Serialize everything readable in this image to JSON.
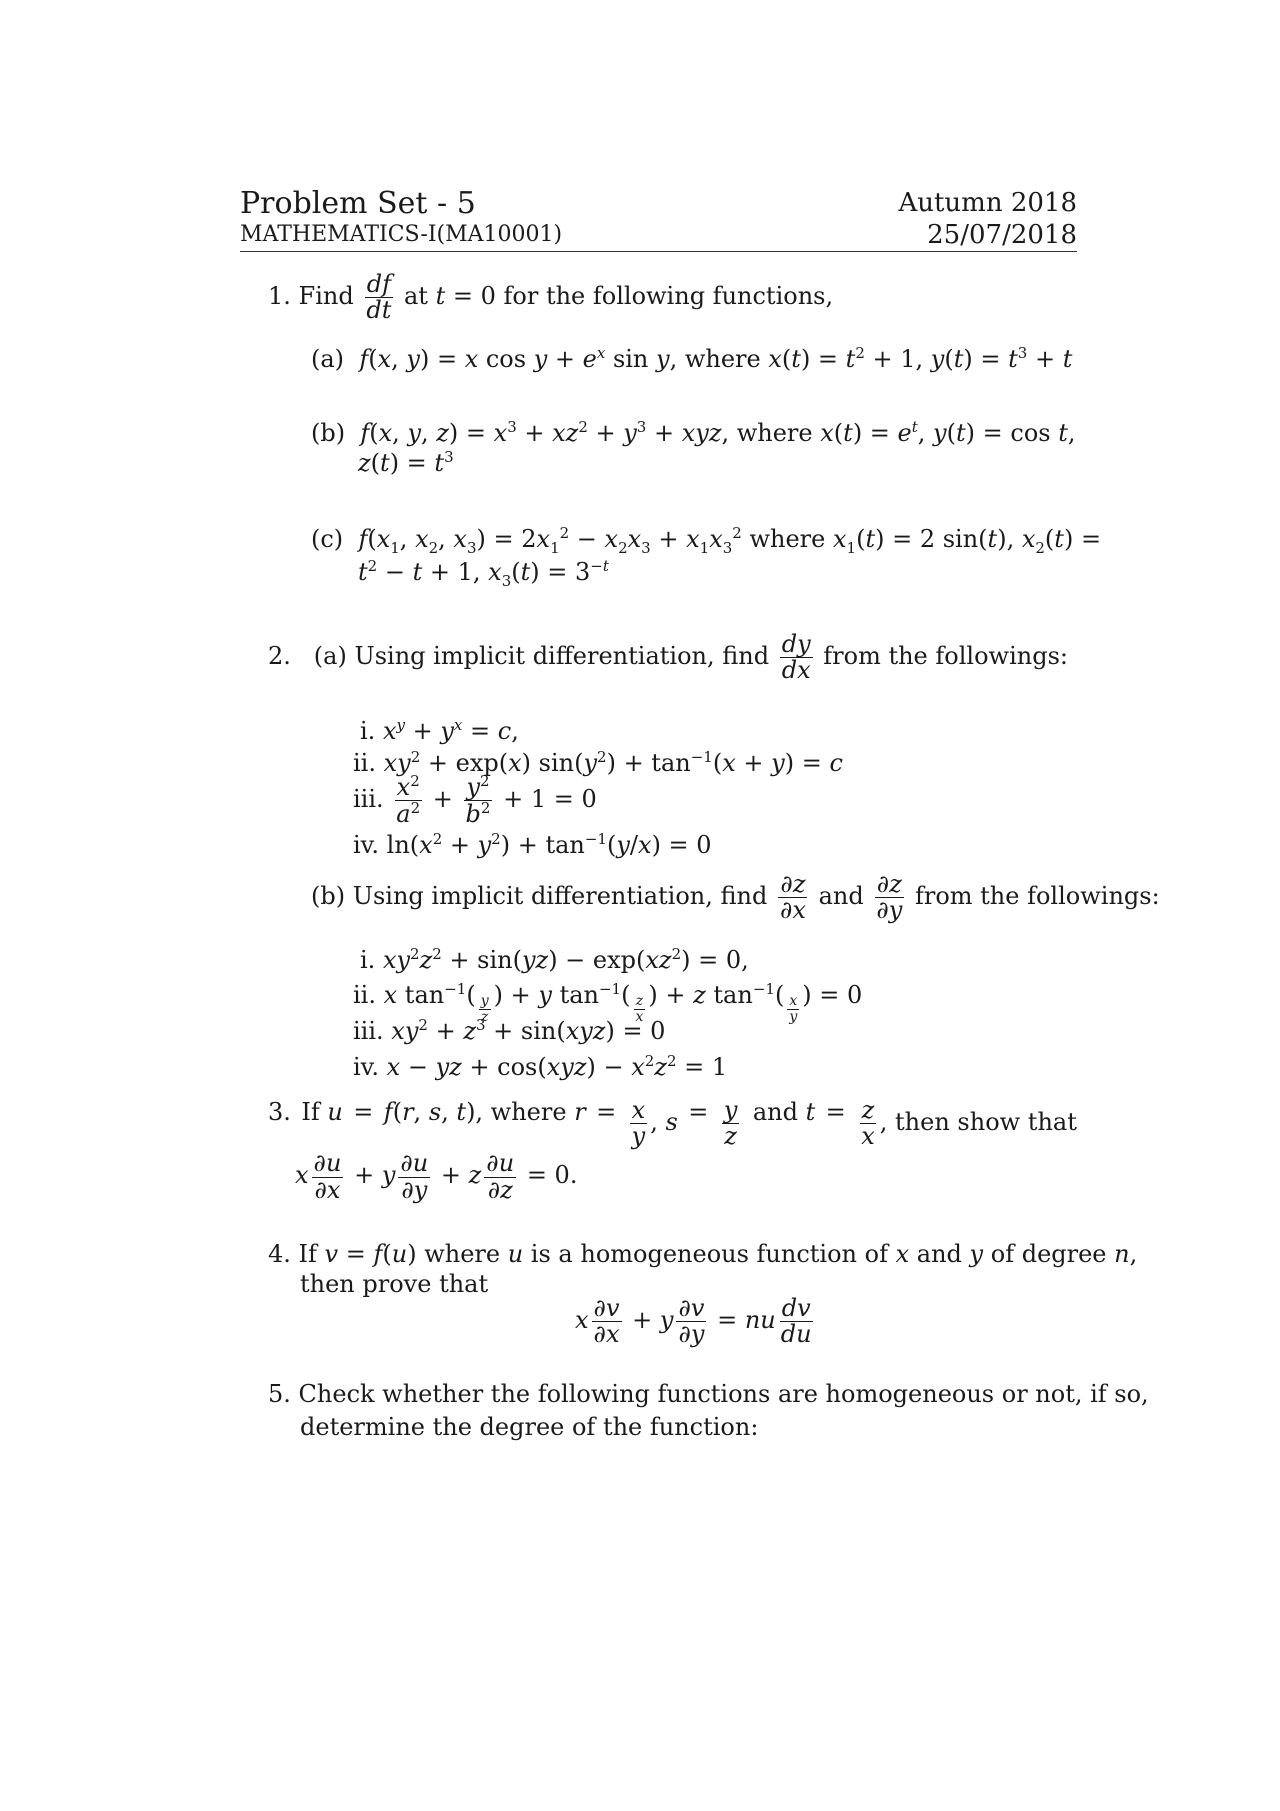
{
  "header": {
    "title": "Problem Set - 5",
    "course": "MATHEMATICS-I(MA10001)",
    "term": "Autumn 2018",
    "date": "25/07/2018"
  },
  "problems": [
    {
      "number": "1.",
      "intro_before": "Find",
      "intro_frac": {
        "num": "df",
        "den": "dt"
      },
      "intro_after": "at t = 0 for the following functions,",
      "parts": [
        {
          "label": "(a)",
          "text": "f(x, y) = x cos y + e^x sin y, where x(t) = t² + 1, y(t) = t³ + t"
        },
        {
          "label": "(b)",
          "line1": "f(x, y, z) = x³ + xz² + y³ + xyz, where x(t) = e^t, y(t) = cos t,",
          "line2": "z(t) = t³"
        },
        {
          "label": "(c)",
          "line1": "f(x₁, x₂, x₃) = 2x₁² − x₂x₃ + x₁x₃² where x₁(t) = 2 sin(t), x₂(t) =",
          "line2": "t² − t + 1, x₃(t) = 3^−t"
        }
      ]
    },
    {
      "number": "2.",
      "parts": [
        {
          "label": "(a)",
          "intro_before": "Using implicit differentiation, find",
          "intro_frac": {
            "num": "dy",
            "den": "dx"
          },
          "intro_after": "from the followings:",
          "items": [
            {
              "label": "i.",
              "text": "x^y + y^x = c,"
            },
            {
              "label": "ii.",
              "text": "xy² + exp(x) sin(y²) + tan⁻¹(x + y) = c"
            },
            {
              "label": "iii.",
              "text": "x²/a² + y²/b² + 1 = 0"
            },
            {
              "label": "iv.",
              "text": "ln(x² + y²) + tan⁻¹(y/x) = 0"
            }
          ]
        },
        {
          "label": "(b)",
          "intro_before": "Using implicit differentiation, find",
          "intro_frac1": {
            "num": "∂z",
            "den": "∂x"
          },
          "intro_mid": "and",
          "intro_frac2": {
            "num": "∂z",
            "den": "∂y"
          },
          "intro_after": "from the followings:",
          "items": [
            {
              "label": "i.",
              "text": "xy²z² + sin(yz) − exp(xz²) = 0,"
            },
            {
              "label": "ii.",
              "text": "x tan⁻¹(y/z) + y tan⁻¹(z/x) + z tan⁻¹(x/y) = 0"
            },
            {
              "label": "iii.",
              "text": "xy² + z³ + sin(xyz) = 0"
            },
            {
              "label": "iv.",
              "text": "x − yz + cos(xyz) − x²z² = 1"
            }
          ]
        }
      ]
    },
    {
      "number": "3.",
      "line1": "If u = f(r, s, t), where r = x/y, s = y/z and t = z/x, then show that",
      "line2": "x ∂u/∂x + y ∂u/∂y + z ∂u/∂z = 0."
    },
    {
      "number": "4.",
      "line1": "If v = f(u) where u is a homogeneous function of x and y of degree n,",
      "line2": "then prove that",
      "display": "x ∂v/∂x + y ∂v/∂y = nu dv/du"
    },
    {
      "number": "5.",
      "line1": "Check whether the following functions are homogeneous or not, if so,",
      "line2": "determine the degree of the function:"
    }
  ],
  "labels": {
    "and": "and",
    "where": "where",
    "then_show_that": "then show that",
    "eq0": "= 0."
  }
}
